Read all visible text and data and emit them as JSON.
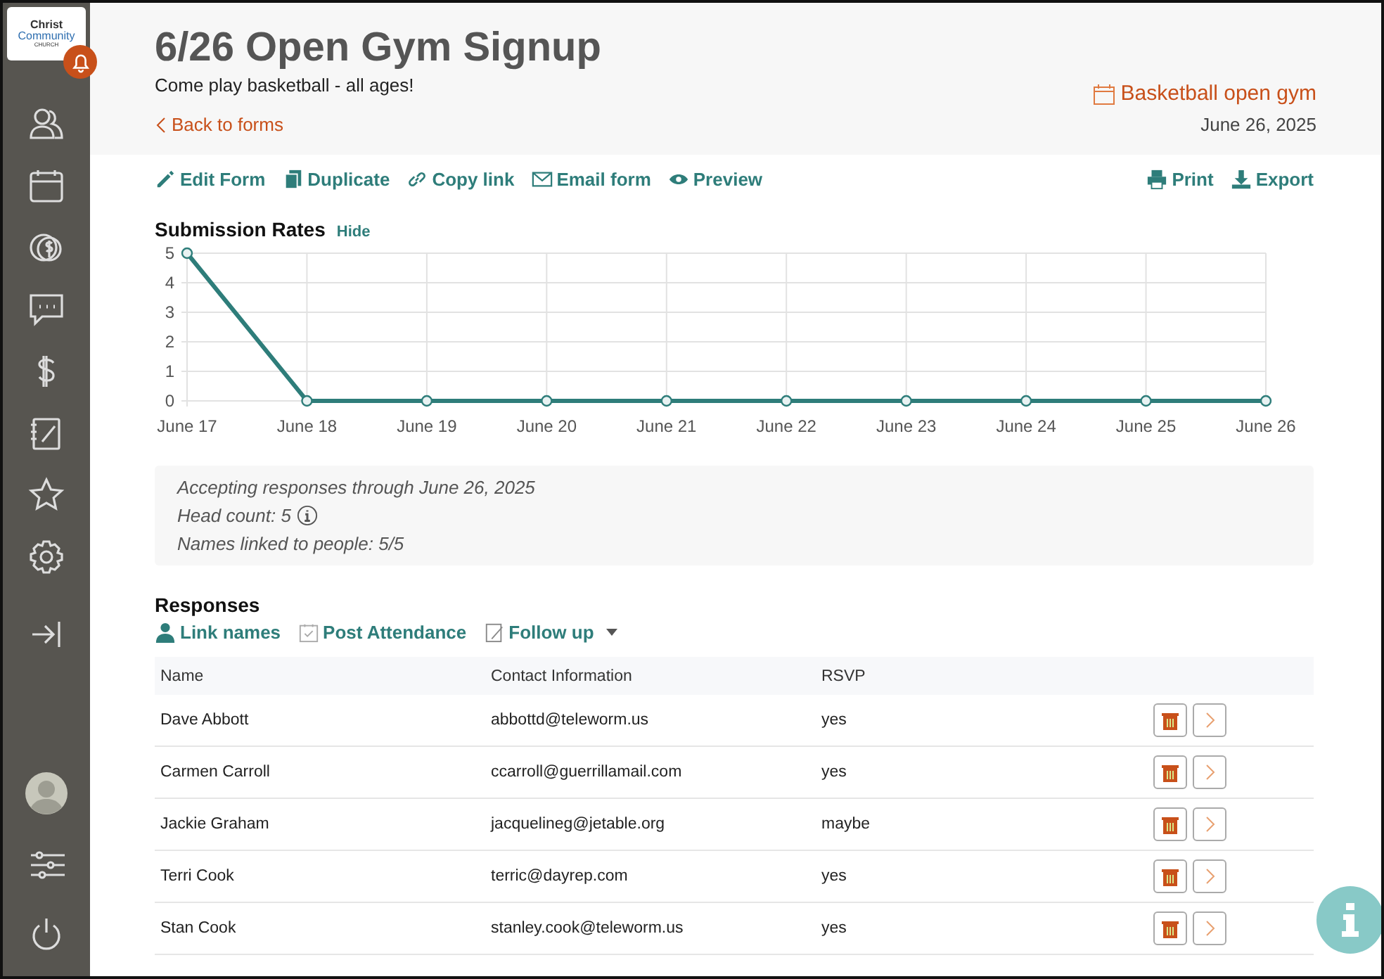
{
  "sidebar": {
    "logo": [
      "Christ",
      "Community",
      "CHURCH"
    ]
  },
  "header": {
    "title": "6/26 Open Gym Signup",
    "subtitle": "Come play basketball - all ages!",
    "back_link": "Back to forms",
    "event_link": "Basketball open gym",
    "event_date": "June 26, 2025"
  },
  "toolbar": {
    "left": [
      {
        "kind": "pencil",
        "label": "Edit Form"
      },
      {
        "kind": "copy",
        "label": "Duplicate"
      },
      {
        "kind": "link",
        "label": "Copy link"
      },
      {
        "kind": "mail",
        "label": "Email form"
      },
      {
        "kind": "eye",
        "label": "Preview"
      }
    ],
    "right": [
      {
        "kind": "print",
        "label": "Print"
      },
      {
        "kind": "download",
        "label": "Export"
      }
    ]
  },
  "submission_rates": {
    "title": "Submission Rates",
    "toggle": "Hide",
    "chart_data": {
      "type": "line",
      "categories": [
        "June 17",
        "June 18",
        "June 19",
        "June 20",
        "June 21",
        "June 22",
        "June 23",
        "June 24",
        "June 25",
        "June 26"
      ],
      "series": [
        {
          "color": "#2e7d7a",
          "values": [
            5,
            0,
            0,
            0,
            0,
            0,
            0,
            0,
            0,
            0
          ]
        }
      ],
      "ylim": [
        0,
        5
      ],
      "yticks": [
        0,
        1,
        2,
        3,
        4,
        5
      ],
      "grid": true,
      "marker": true
    }
  },
  "summary": {
    "accepting": "Accepting responses through June 26, 2025",
    "head_count": "Head count: 5",
    "names_linked": "Names linked to people: 5/5"
  },
  "responses": {
    "title": "Responses",
    "actions": [
      {
        "kind": "person",
        "label": "Link names"
      },
      {
        "kind": "check",
        "label": "Post Attendance"
      },
      {
        "kind": "note",
        "label": "Follow up"
      }
    ],
    "columns": [
      "Name",
      "Contact Information",
      "RSVP"
    ],
    "rows": [
      {
        "name": "Dave Abbott",
        "contact": "abbottd@teleworm.us",
        "rsvp": "yes"
      },
      {
        "name": "Carmen Carroll",
        "contact": "ccarroll@guerrillamail.com",
        "rsvp": "yes"
      },
      {
        "name": "Jackie Graham",
        "contact": "jacquelineg@jetable.org",
        "rsvp": "maybe"
      },
      {
        "name": "Terri Cook",
        "contact": "terric@dayrep.com",
        "rsvp": "yes"
      },
      {
        "name": "Stan Cook",
        "contact": "stanley.cook@teleworm.us",
        "rsvp": "yes"
      }
    ]
  }
}
